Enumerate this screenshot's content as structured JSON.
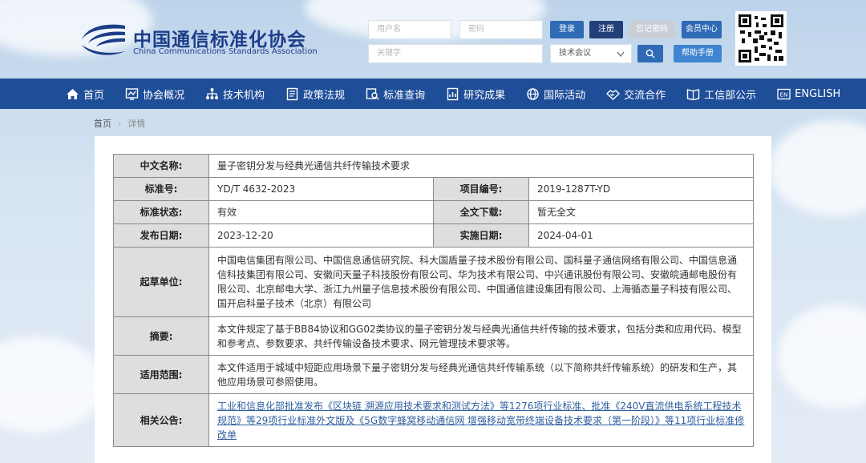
{
  "header": {
    "logo_cn": "中国通信标准化协会",
    "logo_en": "China Communications Standards Association",
    "username_placeholder": "用户名",
    "password_placeholder": "密码",
    "keyword_placeholder": "关键字",
    "login_label": "登录",
    "register_label": "注册",
    "forgot_label": "忘记密码",
    "member_center_label": "会员中心",
    "category_select_value": "技术会议",
    "help_label": "帮助手册"
  },
  "nav": {
    "items": [
      {
        "label": "首页",
        "icon": "home-icon"
      },
      {
        "label": "协会概况",
        "icon": "chart-icon"
      },
      {
        "label": "技术机构",
        "icon": "org-icon"
      },
      {
        "label": "政策法规",
        "icon": "doc-icon"
      },
      {
        "label": "标准查询",
        "icon": "search-doc-icon"
      },
      {
        "label": "研究成果",
        "icon": "report-icon"
      },
      {
        "label": "国际活动",
        "icon": "globe-icon"
      },
      {
        "label": "交流合作",
        "icon": "handshake-icon"
      },
      {
        "label": "工信部公示",
        "icon": "book-icon"
      },
      {
        "label": "ENGLISH",
        "icon": "en-icon"
      }
    ]
  },
  "breadcrumb": {
    "home": "首页",
    "sep": "›",
    "current": "详情"
  },
  "detail": {
    "name_label": "中文名称:",
    "name_value": "量子密钥分发与经典光通信共纤传输技术要求",
    "std_no_label": "标准号:",
    "std_no_value": "YD/T 4632-2023",
    "project_no_label": "项目编号:",
    "project_no_value": "2019-1287T-YD",
    "status_label": "标准状态:",
    "status_value": "有效",
    "download_label": "全文下载:",
    "download_value": "暂无全文",
    "publish_label": "发布日期:",
    "publish_value": "2023-12-20",
    "implement_label": "实施日期:",
    "implement_value": "2024-04-01",
    "drafter_label": "起草单位:",
    "drafter_value": "中国电信集团有限公司、中国信息通信研究院、科大国盾量子技术股份有限公司、国科量子通信网络有限公司、中国信息通信科技集团有限公司、安徽问天量子科技股份有限公司、华为技术有限公司、中兴通讯股份有限公司、安徽皖通邮电股份有限公司、北京邮电大学、浙江九州量子信息技术股份有限公司、中国通信建设集团有限公司、上海循态量子科技有限公司、国开启科量子技术（北京）有限公司",
    "abstract_label": "摘要:",
    "abstract_value": "本文件规定了基于BB84协议和GG02类协议的量子密钥分发与经典光通信共纤传输的技术要求，包括分类和应用代码、模型和参考点、参数要求、共纤传输设备技术要求、网元管理技术要求等。",
    "scope_label": "适用范围:",
    "scope_value": "本文件适用于城域中短距应用场景下量子密钥分发与经典光通信共纤传输系统（以下简称共纤传输系统）的研发和生产，其他应用场景可参照使用。",
    "notice_label": "相关公告:",
    "notice_value": "工业和信息化部批准发布《区块链 溯源应用技术要求和测试方法》等1276项行业标准、批准《240V直流供电系统工程技术规范》等29项行业标准外文版及《5G数字蜂窝移动通信网 增强移动宽带终端设备技术要求（第一阶段）》等11项行业标准修改单"
  }
}
